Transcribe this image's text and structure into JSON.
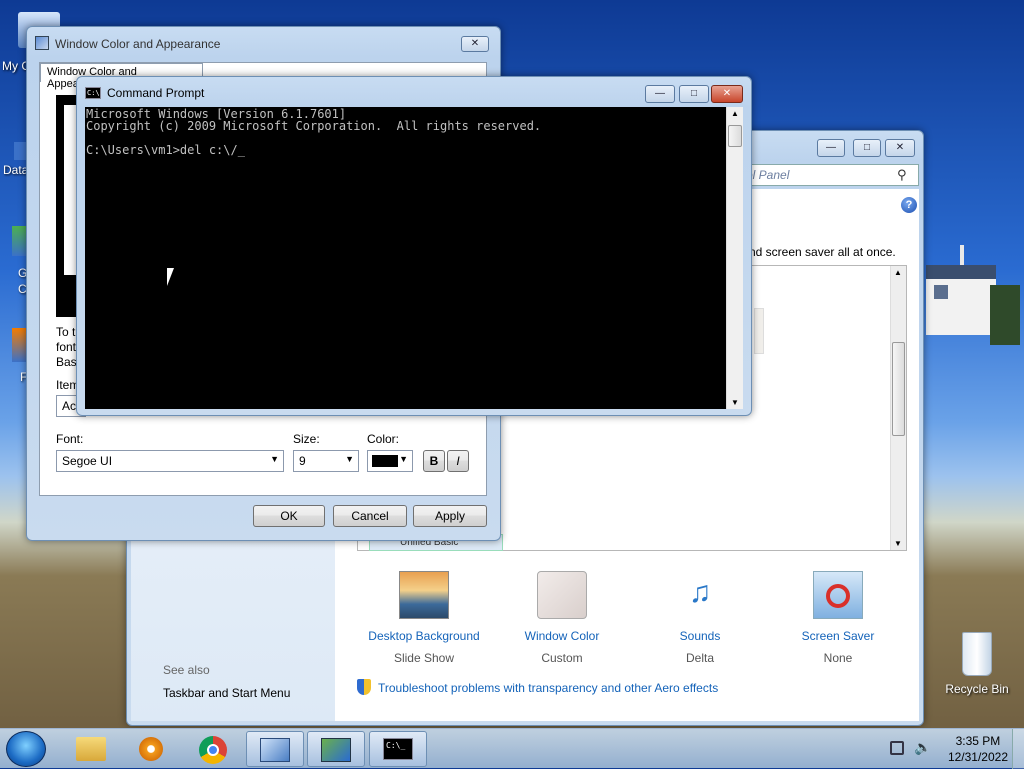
{
  "desktop": {
    "left_icon_fragments": [
      "My C",
      "Data",
      "G",
      "C",
      "F"
    ],
    "recycle_bin_label": "Recycle Bin"
  },
  "control_panel": {
    "search_placeholder": "ol Panel",
    "description_fragment": "nd screen saver all at once.",
    "list_fragment": "Unified Basic",
    "see_also_label": "See also",
    "taskbar_link": "Taskbar and Start Menu",
    "items": [
      {
        "label": "Desktop Background",
        "sub": "Slide Show",
        "icon": "landscape-icon"
      },
      {
        "label": "Window Color",
        "sub": "Custom",
        "icon": "color-swatch-icon"
      },
      {
        "label": "Sounds",
        "sub": "Delta",
        "icon": "music-notes-icon"
      },
      {
        "label": "Screen Saver",
        "sub": "None",
        "icon": "screensaver-icon"
      }
    ],
    "troubleshoot_link": "Troubleshoot problems with transparency and other Aero effects"
  },
  "wca": {
    "title": "Window Color and Appearance",
    "tab_label": "Window Color and Appearance",
    "desc_lines": [
      "To t",
      "font",
      "Basi"
    ],
    "item_label": "Item",
    "item_value": "Act",
    "font_label": "Font:",
    "font_value": "Segoe UI",
    "size_label": "Size:",
    "size_value": "9",
    "color_label": "Color:",
    "bold_label": "B",
    "italic_label": "I",
    "ok_label": "OK",
    "cancel_label": "Cancel",
    "apply_label": "Apply"
  },
  "cmd": {
    "title": "Command Prompt",
    "lines": [
      "Microsoft Windows [Version 6.1.7601]",
      "Copyright (c) 2009 Microsoft Corporation.  All rights reserved.",
      "",
      "C:\\Users\\vm1>del c:\\/_"
    ]
  },
  "taskbar": {
    "time": "3:35 PM",
    "date": "12/31/2022"
  }
}
